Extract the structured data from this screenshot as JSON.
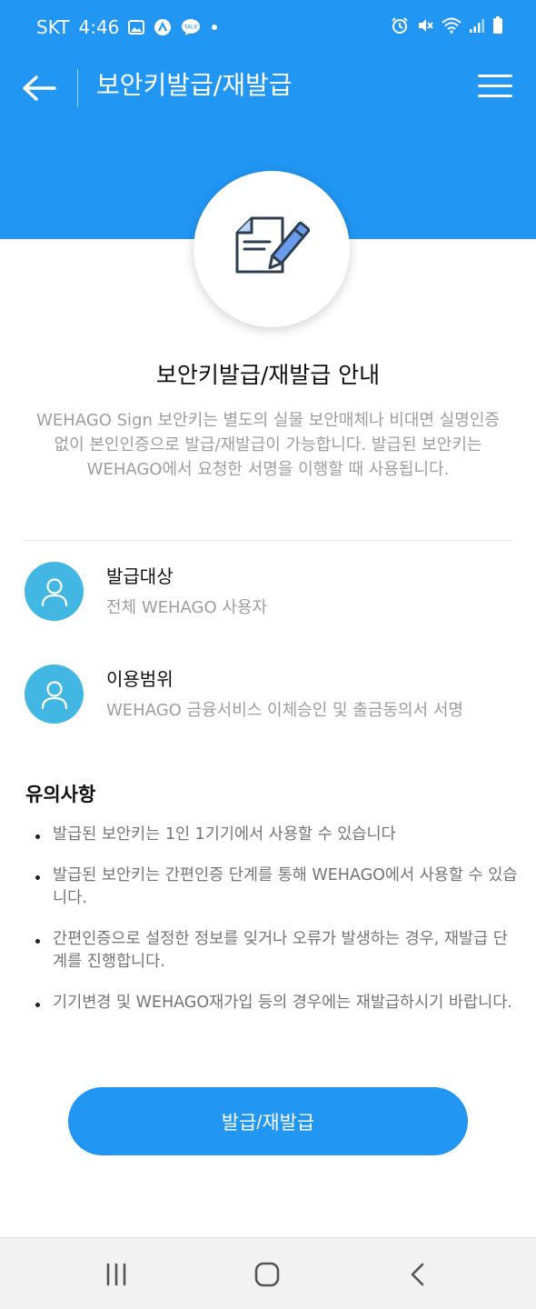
{
  "status_bar": {
    "carrier": "SKT",
    "time": "4:46",
    "left_icons": [
      "gallery-icon",
      "app-notification-icon",
      "talk-icon",
      "dot-icon"
    ],
    "right_icons": [
      "alarm-icon",
      "mute-icon",
      "wifi-icon",
      "signal-icon",
      "battery-icon"
    ]
  },
  "app_bar": {
    "title": "보안키발급/재발급",
    "back_icon": "arrow-left-icon",
    "menu_icon": "hamburger-menu-icon"
  },
  "hero": {
    "icon": "document-pen-icon"
  },
  "info": {
    "title": "보안키발급/재발급 안내",
    "description": "WEHAGO Sign 보안키는 별도의 실물 보안매체나 비대면 실명인증 없이 본인인증으로 발급/재발급이 가능합니다. 발급된 보안키는 WEHAGO에서 요청한 서명을 이행할 때 사용됩니다."
  },
  "features": [
    {
      "label": "발급대상",
      "value": "전체 WEHAGO 사용자",
      "icon": "user-icon"
    },
    {
      "label": "이용범위",
      "value": "WEHAGO 금융서비스 이체승인 및 출금동의서 서명",
      "icon": "user-icon"
    }
  ],
  "notice": {
    "title": "유의사항",
    "items": [
      "발급된 보안키는 1인 1기기에서 사용할 수 있습니다",
      "발급된 보안키는 간편인증 단계를 통해 WEHAGO에서 사용할 수 있습니다.",
      "간편인증으로 설정한 정보를 잊거나 오류가 발생하는 경우, 재발급 단계를 진행합니다.",
      "기기변경 및 WEHAGO재가입 등의 경우에는 재발급하시기 바랍니다."
    ]
  },
  "action": {
    "button_label": "발급/재발급"
  },
  "nav_bar": {
    "icons": [
      "recent-apps-icon",
      "home-icon",
      "back-icon"
    ]
  },
  "colors": {
    "primary": "#2196f3",
    "avatar": "#42b7e4",
    "muted_text": "#9e9e9e",
    "nav_bg": "#f2f2f2"
  }
}
